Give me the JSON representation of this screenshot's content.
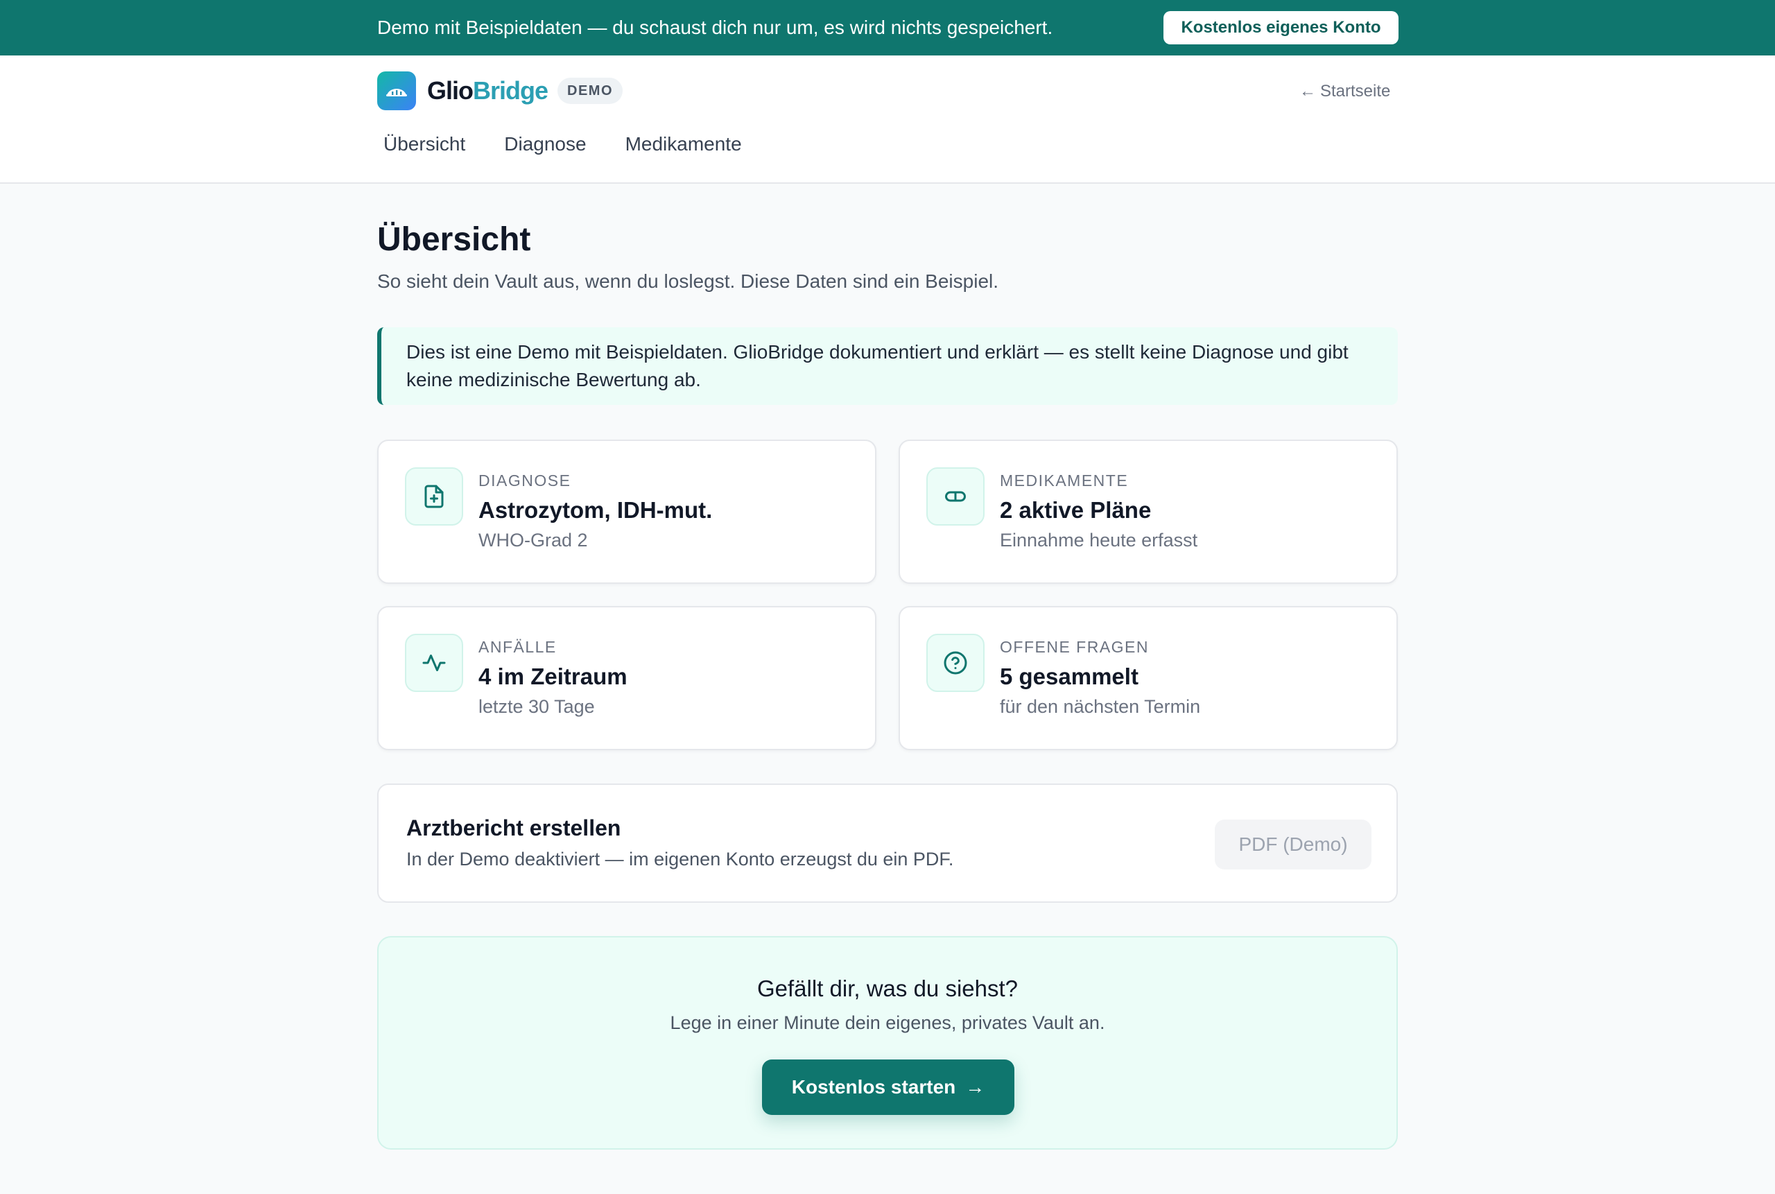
{
  "banner": {
    "text": "Demo mit Beispieldaten — du schaust dich nur um, es wird nichts gespeichert.",
    "button_label": "Kostenlos eigenes Konto"
  },
  "header": {
    "logo_part1": "Glio",
    "logo_part2": "Bridge",
    "badge": "DEMO",
    "back_link": "Startseite",
    "back_arrow": "←",
    "nav": [
      "Übersicht",
      "Diagnose",
      "Medikamente"
    ]
  },
  "main": {
    "title": "Übersicht",
    "subtitle": "So sieht dein Vault aus, wenn du loslegst. Diese Daten sind ein Beispiel.",
    "notice": "Dies ist eine Demo mit Beispieldaten. GlioBridge dokumentiert und erklärt — es stellt keine Diagnose und gibt keine medizinische Bewertung ab.",
    "cards": [
      {
        "icon": "file-plus-icon",
        "label": "DIAGNOSE",
        "value": "Astrozytom, IDH-mut.",
        "sub": "WHO-Grad 2"
      },
      {
        "icon": "pill-icon",
        "label": "MEDIKAMENTE",
        "value": "2 aktive Pläne",
        "sub": "Einnahme heute erfasst"
      },
      {
        "icon": "activity-icon",
        "label": "ANFÄLLE",
        "value": "4 im Zeitraum",
        "sub": "letzte 30 Tage"
      },
      {
        "icon": "help-circle-icon",
        "label": "OFFENE FRAGEN",
        "value": "5 gesammelt",
        "sub": "für den nächsten Termin"
      }
    ],
    "report": {
      "title": "Arztbericht erstellen",
      "sub": "In der Demo deaktiviert — im eigenen Konto erzeugst du ein PDF.",
      "button_label": "PDF (Demo)"
    },
    "cta": {
      "title": "Gefällt dir, was du siehst?",
      "sub": "Lege in einer Minute dein eigenes, privates Vault an.",
      "button_label": "Kostenlos starten",
      "button_arrow": "→"
    }
  },
  "colors": {
    "accent": "#0f766e",
    "accent_light": "#ecfdf8",
    "text": "#111827",
    "muted": "#6b7280"
  }
}
